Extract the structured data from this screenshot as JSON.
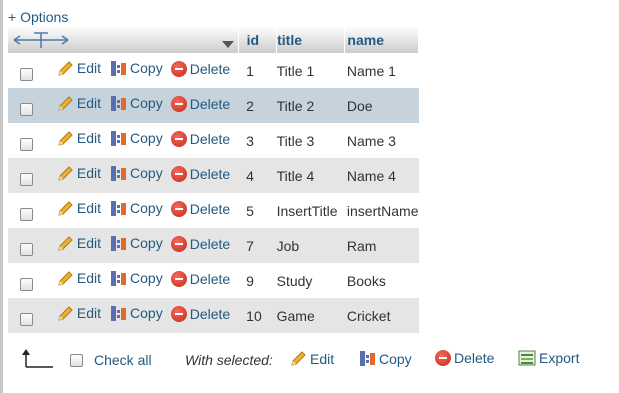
{
  "options_label": "+ Options",
  "columns": {
    "id": "id",
    "title": "title",
    "name": "name"
  },
  "actions": {
    "edit": "Edit",
    "copy": "Copy",
    "delete": "Delete"
  },
  "rows": [
    {
      "id": "1",
      "title": "Title 1",
      "name": "Name 1",
      "state": "odd"
    },
    {
      "id": "2",
      "title": "Title 2",
      "name": "Doe",
      "state": "marked"
    },
    {
      "id": "3",
      "title": "Title 3",
      "name": "Name 3",
      "state": "odd"
    },
    {
      "id": "4",
      "title": "Title 4",
      "name": "Name 4",
      "state": "even"
    },
    {
      "id": "5",
      "title": "InsertTitle",
      "name": "insertName",
      "state": "odd"
    },
    {
      "id": "7",
      "title": "Job",
      "name": "Ram",
      "state": "even"
    },
    {
      "id": "9",
      "title": "Study",
      "name": "Books",
      "state": "odd"
    },
    {
      "id": "10",
      "title": "Game",
      "name": "Cricket",
      "state": "even"
    }
  ],
  "footer": {
    "check_all": "Check all",
    "with_selected": "With selected:",
    "edit": "Edit",
    "copy": "Copy",
    "delete": "Delete",
    "export": "Export"
  },
  "colors": {
    "link": "#235a81",
    "marked_row": "#c6d2dc",
    "even_row": "#e5e5e5",
    "delete_red": "#d9362a"
  }
}
